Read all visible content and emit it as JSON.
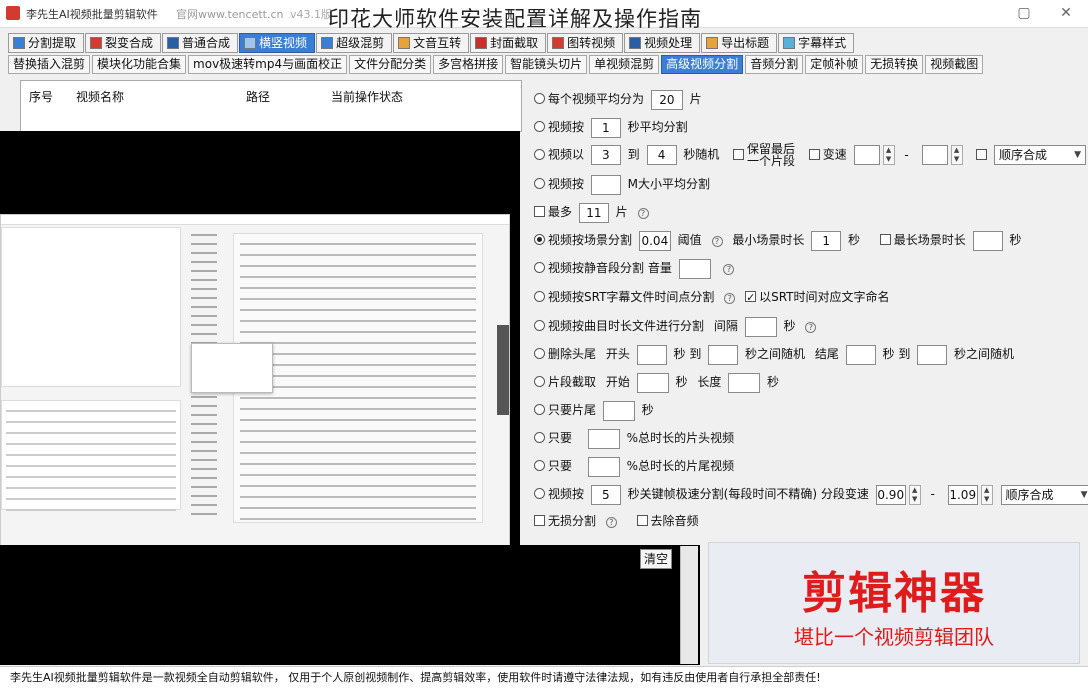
{
  "window": {
    "title": "李先生AI视频批量剪辑软件",
    "site": "官网www.tencett.cn",
    "version": "v43.1版",
    "overlay_title": "印花大师软件安装配置详解及操作指南"
  },
  "main_tabs": [
    {
      "label": "分割提取"
    },
    {
      "label": "裂变合成"
    },
    {
      "label": "普通合成"
    },
    {
      "label": "横竖视频"
    },
    {
      "label": "超级混剪"
    },
    {
      "label": "文音互转"
    },
    {
      "label": "封面截取"
    },
    {
      "label": "图转视频"
    },
    {
      "label": "视频处理"
    },
    {
      "label": "导出标题"
    },
    {
      "label": "字幕样式"
    }
  ],
  "sub_tabs": [
    {
      "label": "替换插入混剪"
    },
    {
      "label": "模块化功能合集"
    },
    {
      "label": "mov极速转mp4与画面校正"
    },
    {
      "label": "文件分配分类"
    },
    {
      "label": "多宫格拼接"
    },
    {
      "label": "智能镜头切片"
    },
    {
      "label": "单视频混剪"
    },
    {
      "label": "高级视频分割"
    },
    {
      "label": "音频分割"
    },
    {
      "label": "定帧补帧"
    },
    {
      "label": "无损转换"
    },
    {
      "label": "视频截图"
    }
  ],
  "list_headers": [
    "序号",
    "视频名称",
    "路径",
    "当前操作状态"
  ],
  "settings": {
    "r1": {
      "label": "每个视频平均分为",
      "value": "20",
      "unit": "片"
    },
    "r2": {
      "label": "视频按",
      "value": "1",
      "unit": "秒平均分割"
    },
    "r3": {
      "label": "视频以",
      "min": "3",
      "to": "到",
      "max": "4",
      "unit": "秒随机",
      "keep_last_1": "保留最后",
      "keep_last_2": "一个片段",
      "speed": "变速",
      "dash": "-",
      "order": "顺序合成"
    },
    "r4": {
      "label": "视频按",
      "unit": "M大小平均分割"
    },
    "r5": {
      "label": "最多",
      "value": "11",
      "unit": "片"
    },
    "r6": {
      "label": "视频按场景分割",
      "value": "0.04",
      "threshold": "阈值",
      "min_label": "最小场景时长",
      "min_value": "1",
      "sec": "秒",
      "max_label": "最长场景时长",
      "max_sec": "秒"
    },
    "r7": {
      "label": "视频按静音段分割 音量"
    },
    "r8": {
      "label": "视频按SRT字幕文件时间点分割",
      "chk": "以SRT时间对应文字命名"
    },
    "r9": {
      "label": "视频按曲目时长文件进行分割",
      "interval": "间隔",
      "sec": "秒"
    },
    "r10": {
      "label": "删除头尾",
      "head": "开头",
      "s1": "秒 到",
      "s2": "秒之间随机",
      "tail": "结尾",
      "s3": "秒 到",
      "s4": "秒之间随机"
    },
    "r11": {
      "label": "片段截取",
      "start": "开始",
      "sec": "秒",
      "len": "长度",
      "sec2": "秒"
    },
    "r12": {
      "label": "只要片尾",
      "sec": "秒"
    },
    "r13": {
      "label": "只要",
      "unit": "%总时长的片头视频"
    },
    "r14": {
      "label": "只要",
      "unit": "%总时长的片尾视频"
    },
    "r15": {
      "label": "视频按",
      "value": "5",
      "unit": "秒关键帧极速分割(每段时间不精确)",
      "speed": "分段变速",
      "v1": "0.90",
      "dash": "-",
      "v2": "1.09",
      "order": "顺序合成"
    },
    "r16": {
      "lossless": "无损分割",
      "remove_audio": "去除音频"
    }
  },
  "clear_label": "清空",
  "ad": {
    "title": "剪辑神器",
    "subtitle": "堪比一个视频剪辑团队",
    "color": "#e01b1b"
  },
  "status_text": "李先生AI视频批量剪辑软件是一款视频全自动剪辑软件， 仅用于个人原创视频制作、提高剪辑效率，使用软件时请遵守法律法规，如有违反由使用者自行承担全部责任!",
  "colors": {
    "accent": "#3a7fd5"
  }
}
